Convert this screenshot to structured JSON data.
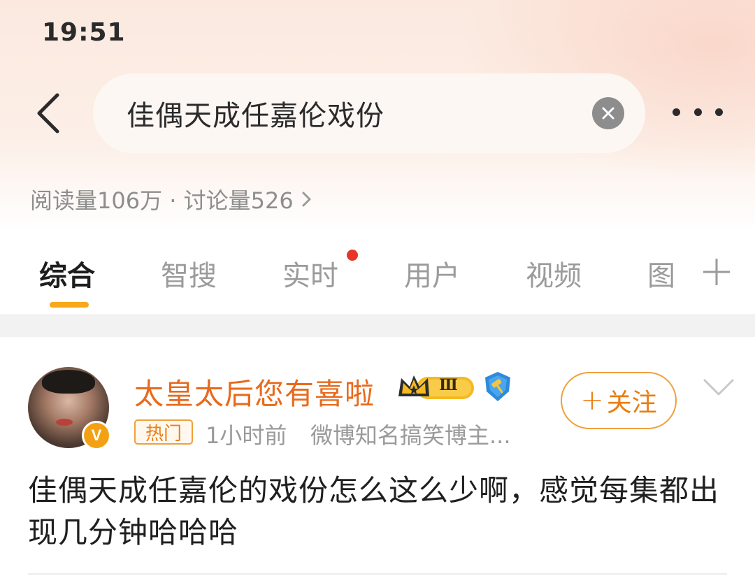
{
  "status_bar": {
    "time": "19:51"
  },
  "search": {
    "query": "佳偶天成任嘉伦戏份"
  },
  "topic_stats": {
    "text": "阅读量106万 · 讨论量526"
  },
  "tabs": [
    {
      "label": "综合",
      "active": true
    },
    {
      "label": "智搜",
      "active": false
    },
    {
      "label": "实时",
      "active": false,
      "has_dot": true
    },
    {
      "label": "用户",
      "active": false
    },
    {
      "label": "视频",
      "active": false
    },
    {
      "label": "图",
      "active": false
    }
  ],
  "post": {
    "username": "太皇太后您有喜啦",
    "level_badge": "Ⅲ",
    "hot_tag": "热门",
    "time": "1小时前",
    "description": "微博知名搞笑博主...",
    "follow_label": "关注",
    "follow_plus": "+",
    "avatar_badge": "V",
    "text": "佳偶天成任嘉伦的戏份怎么这么少啊，感觉每集都出现几分钟哈哈哈"
  },
  "colors": {
    "accent_orange": "#e86a1c",
    "tab_indicator": "#f7a81b",
    "red_dot": "#e8352a"
  },
  "icons": {
    "back": "chevron-left-icon",
    "clear": "close-circle-icon",
    "more": "more-dots-icon",
    "stats_chevron": "chevron-right-icon",
    "add_tab": "plus-icon",
    "collapse": "chevron-down-icon",
    "crown": "crown-icon",
    "verified": "blue-verified-icon"
  }
}
